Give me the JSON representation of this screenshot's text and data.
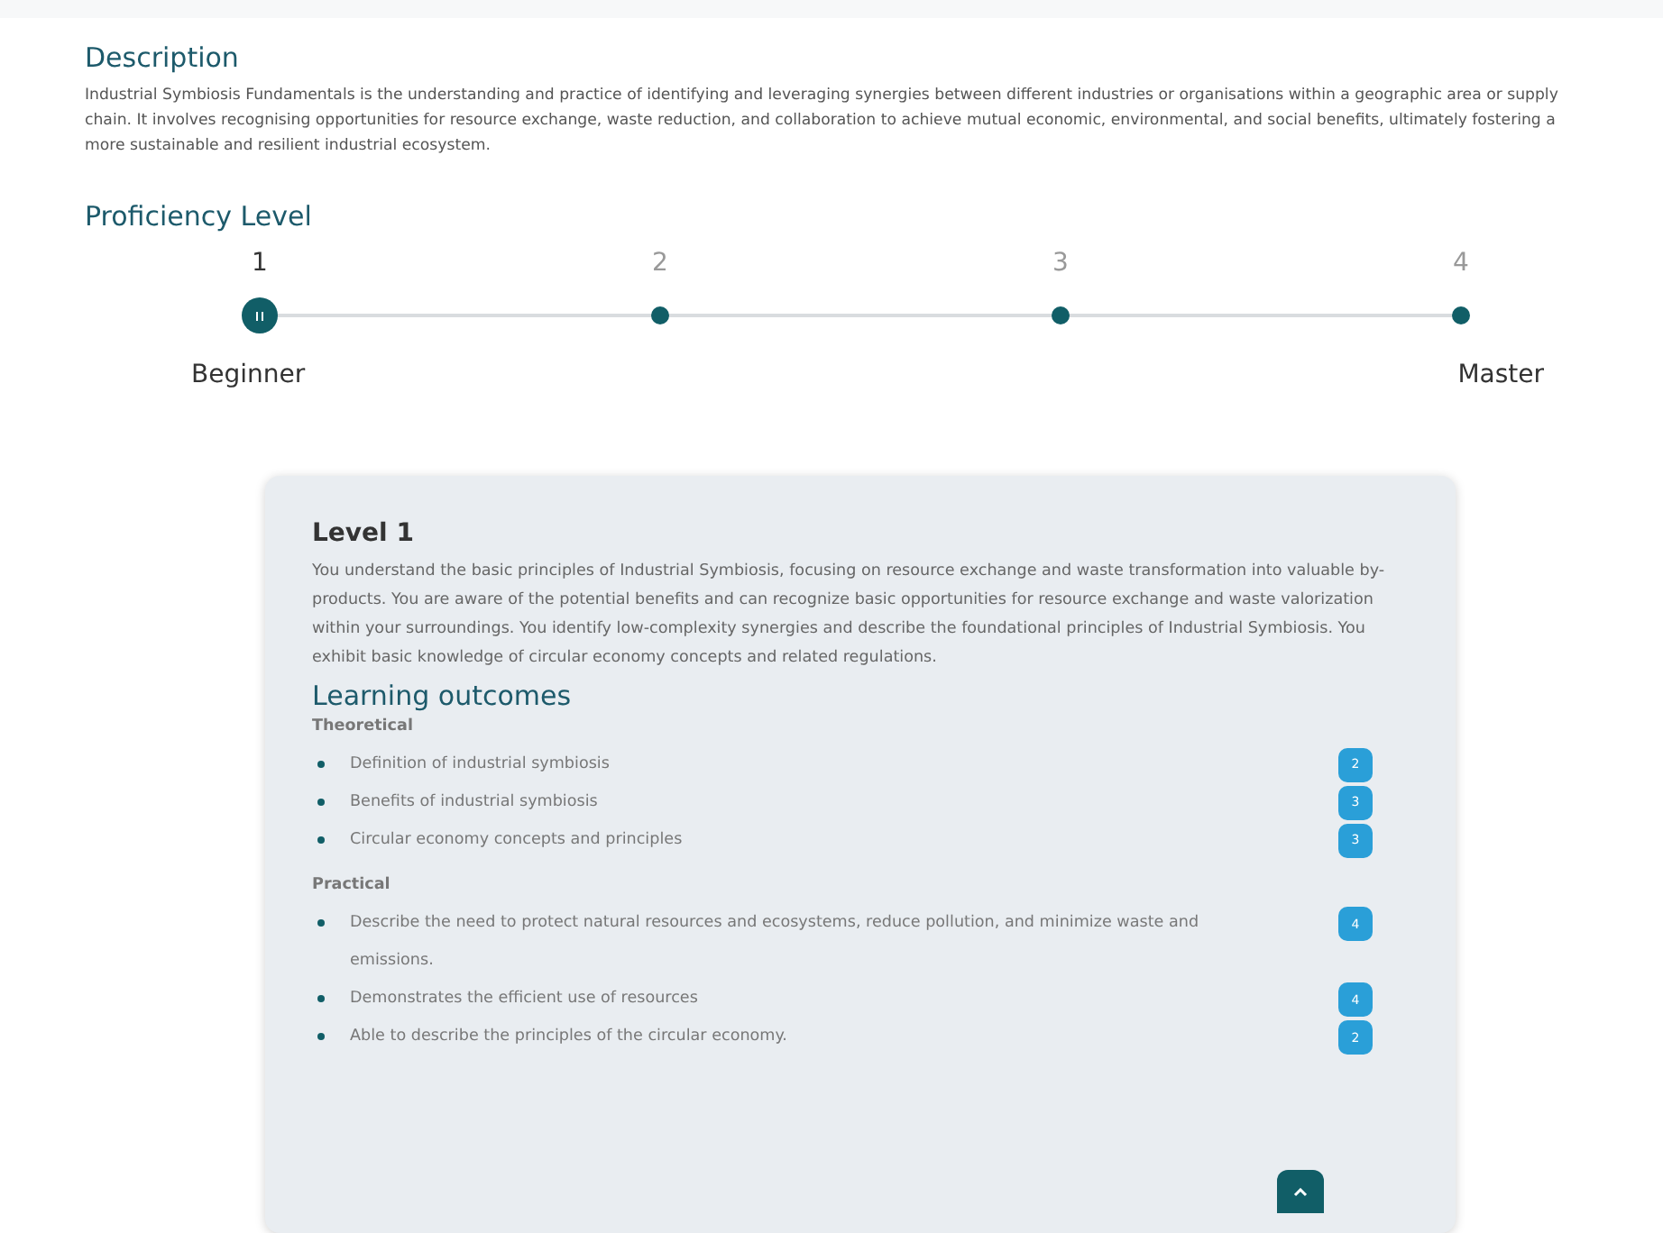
{
  "description": {
    "heading": "Description",
    "text": "Industrial Symbiosis Fundamentals is the understanding and practice of identifying and leveraging synergies between different industries or organisations within a geographic area or supply chain. It involves recognising opportunities for resource exchange, waste reduction, and collaboration to achieve mutual economic, environmental, and social benefits, ultimately fostering a more sustainable and resilient industrial ecosystem."
  },
  "proficiency": {
    "heading": "Proficiency Level",
    "steps": [
      {
        "number": "1",
        "selected": true
      },
      {
        "number": "2",
        "selected": false
      },
      {
        "number": "3",
        "selected": false
      },
      {
        "number": "4",
        "selected": false
      }
    ],
    "min_label": "Beginner",
    "max_label": "Master"
  },
  "level_card": {
    "title": "Level 1",
    "text": "You understand the basic principles of Industrial Symbiosis, focusing on resource exchange and waste transformation into valuable by-products. You are aware of the potential benefits and can recognize basic opportunities for resource exchange and waste valorization within your surroundings. You identify low-complexity synergies and describe the foundational principles of Industrial Symbiosis. You exhibit basic knowledge of circular economy concepts and related regulations.",
    "outcomes_heading": "Learning outcomes",
    "groups": [
      {
        "heading": "Theoretical",
        "items": [
          {
            "text": "Definition of industrial symbiosis",
            "badge": "2"
          },
          {
            "text": "Benefits of industrial symbiosis",
            "badge": "3"
          },
          {
            "text": "Circular economy concepts and principles",
            "badge": "3"
          }
        ]
      },
      {
        "heading": "Practical",
        "items": [
          {
            "text": "Describe the need to protect natural resources and ecosystems, reduce pollution, and minimize waste and emissions.",
            "badge": "4"
          },
          {
            "text": "Demonstrates the efficient use of resources",
            "badge": "4"
          },
          {
            "text": "Able to describe the principles of the circular economy.",
            "badge": "2"
          }
        ]
      }
    ]
  }
}
